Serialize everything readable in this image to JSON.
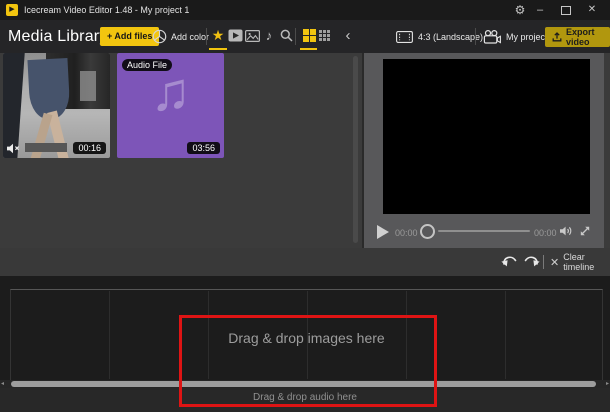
{
  "window": {
    "title": "Icecream Video Editor 1.48 - My project 1"
  },
  "titlebar_icons": {
    "app_play": "▶",
    "gear": "⚙",
    "minimize": "–",
    "close": "✕"
  },
  "library": {
    "heading": "Media Library",
    "add_files_label": "+ Add files",
    "add_color_label": "Add color"
  },
  "glyphs": {
    "star": "★",
    "music_note": "♪",
    "audio_note": "♫",
    "chevron_left": "‹",
    "scroll_left": "◂",
    "scroll_right": "▸"
  },
  "header_right": {
    "aspect_label": "4:3 (Landscape)",
    "my_projects_label": "My projects",
    "export_label": "Export video"
  },
  "media_items": [
    {
      "type": "video",
      "duration": "00:16"
    },
    {
      "type": "audio",
      "badge": "Audio File",
      "duration": "03:56"
    }
  ],
  "preview": {
    "elapsed": "00:00",
    "total": "00:00"
  },
  "actions": {
    "clear_icon": "✕",
    "clear_timeline_label": "Clear timeline"
  },
  "timeline": {
    "images_hint": "Drag & drop images here",
    "audio_hint": "Drag & drop audio here"
  },
  "colors": {
    "accent_yellow": "#f2c50f",
    "export_gold": "#b1970e",
    "audio_purple": "#7d55b8",
    "annotation_red": "#de1414",
    "panel_gray": "#58585a"
  }
}
